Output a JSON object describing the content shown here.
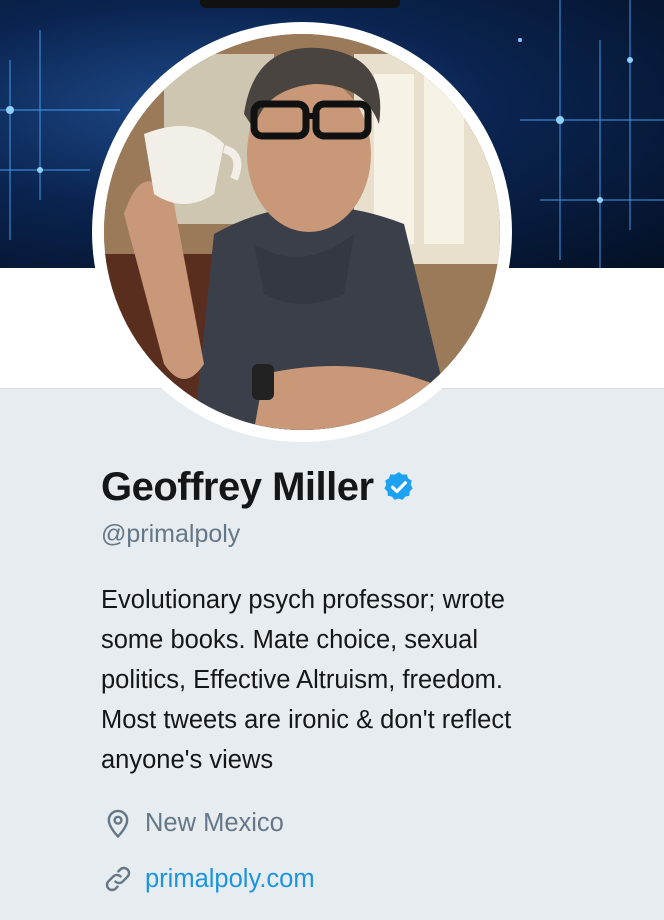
{
  "profile": {
    "name": "Geoffrey Miller",
    "handle": "@primalpoly",
    "bio_lines": [
      "Evolutionary psych professor; wrote",
      "some books. Mate choice, sexual",
      "politics, Effective Altruism, freedom.",
      "Most tweets are ironic & don't reflect",
      "anyone's views"
    ],
    "verified": true,
    "location": "New Mexico",
    "website": "primalpoly.com"
  },
  "icons": {
    "verified": "verified-badge-icon",
    "location": "map-pin-icon",
    "website": "link-icon"
  },
  "colors": {
    "background": "#e6ecf0",
    "name": "#14171a",
    "secondary": "#657786",
    "link": "#1b95e0",
    "verified": "#1da1f2",
    "banner": "#0a2450"
  }
}
